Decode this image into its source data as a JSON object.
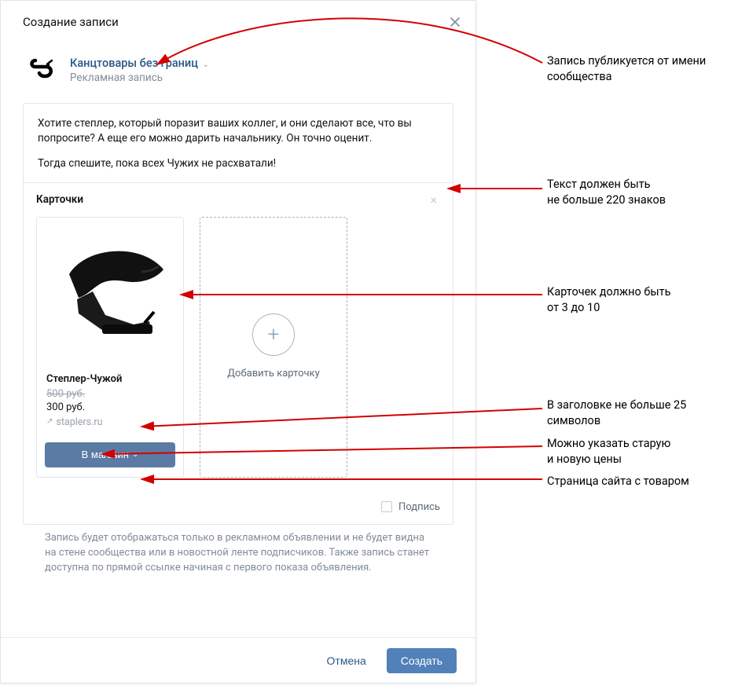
{
  "modal": {
    "title": "Создание записи",
    "author": {
      "name": "Канцтовары без границ",
      "sub": "Рекламная запись"
    },
    "post_text_p1": "Хотите степлер, который поразит ваших коллег, и они сделают все, что вы попросите? А еще его можно дарить начальнику. Он точно оценит.",
    "post_text_p2": "Тогда спешите, пока всех Чужих не расхватали!",
    "cards": {
      "heading": "Карточки",
      "card": {
        "title": "Степлер-Чужой",
        "old_price": "500 руб.",
        "new_price": "300 руб.",
        "link": "staplers.ru",
        "button": "В магазин"
      },
      "add_label": "Добавить карточку"
    },
    "signature_label": "Подпись",
    "footnote": "Запись будет отображаться только в рекламном объявлении и не будет видна на стене сообщества или в новостной ленте подписчиков. Также запись станет доступна по прямой ссылке начиная с первого показа объявления.",
    "cancel": "Отмена",
    "create": "Создать"
  },
  "annotations": {
    "a1": "Запись публикуется от имени сообщества",
    "a2_l1": "Текст должен быть",
    "a2_l2": "не больше 220 знаков",
    "a3_l1": "Карточек должно быть",
    "a3_l2": "от 3 до 10",
    "a4_l1": "В заголовке не больше 25",
    "a4_l2": "символов",
    "a5_l1": "Можно указать старую",
    "a5_l2": "и новую цены",
    "a6": "Страница сайта с товаром"
  }
}
